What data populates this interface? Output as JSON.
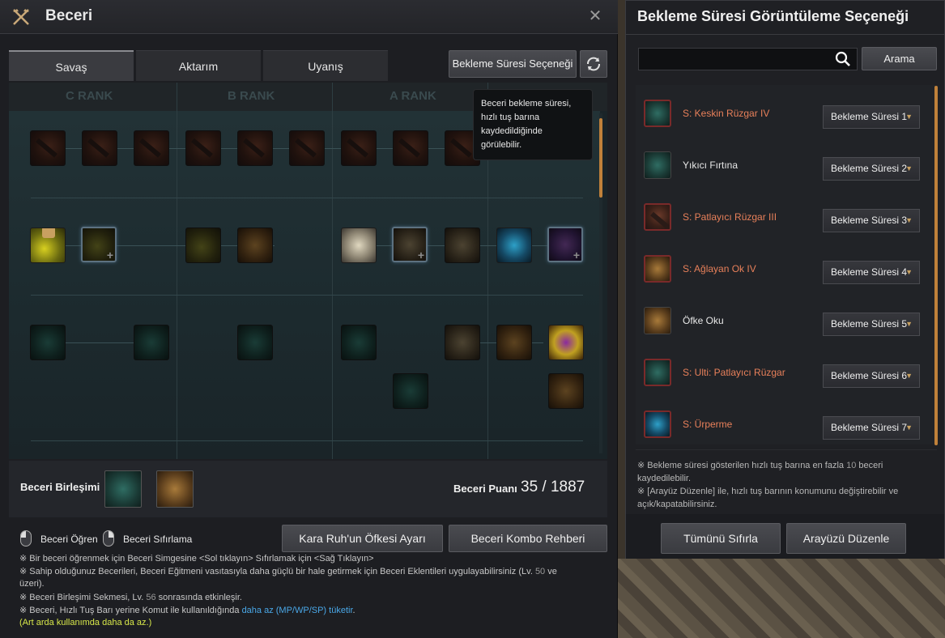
{
  "skill_window": {
    "title": "Beceri",
    "close": "✕",
    "tabs": [
      "Savaş",
      "Aktarım",
      "Uyanış"
    ],
    "cooldown_option_button": "Bekleme Süresi Seçeneği",
    "ranks": [
      "C RANK",
      "B RANK",
      "A RANK"
    ],
    "tooltip": "Beceri bekleme süresi, hızlı tuş barına kaydedildiğinde görülebilir.",
    "combine_label": "Beceri Birleşimi",
    "skill_points_label": "Beceri Puanı",
    "skill_points_value": "35 / 1887",
    "learn_hint": "Beceri Öğren",
    "reset_hint": "Beceri Sıfırlama",
    "rage_button": "Kara Ruh'un Öfkesi Ayarı",
    "combo_button": "Beceri Kombo Rehberi",
    "notes": {
      "n1": "※ Bir beceri öğrenmek için Beceri Simgesine <Sol tıklayın> Sıfırlamak için <Sağ Tıklayın>",
      "n2a": "※ Sahip olduğunuz Becerileri, Beceri Eğitmeni vasıtasıyla daha güçlü bir hale getirmek için Beceri Eklentileri uygulayabilirsiniz (Lv. ",
      "n2num": "50",
      "n2b": " ve",
      "n2c": "üzeri).",
      "n3a": "※ Beceri Birleşimi Sekmesi, Lv. ",
      "n3num": "56",
      "n3b": " sonrasında etkinleşir.",
      "n4a": "※ Beceri, Hızlı Tuş Barı yerine Komut ile kullanıldığında ",
      "n4blue": "daha az (MP/WP/SP) tüketir",
      "n4b": ".",
      "n5": "(Art arda kullanımda daha da az.)"
    }
  },
  "cooldown_panel": {
    "title": "Bekleme Süresi Görüntüleme Seçeneği",
    "search_placeholder": "",
    "search_button": "Arama",
    "rows": [
      {
        "name": "S: Keskin Rüzgar IV",
        "value": "Bekleme Süresi 1",
        "color": "red"
      },
      {
        "name": "Yıkıcı Fırtına",
        "value": "Bekleme Süresi 2",
        "color": "white"
      },
      {
        "name": "S: Patlayıcı Rüzgar III",
        "value": "Bekleme Süresi 3",
        "color": "red"
      },
      {
        "name": "S: Ağlayan Ok IV",
        "value": "Bekleme Süresi 4",
        "color": "red"
      },
      {
        "name": "Öfke Oku",
        "value": "Bekleme Süresi 5",
        "color": "white"
      },
      {
        "name": "S: Ulti: Patlayıcı Rüzgar",
        "value": "Bekleme Süresi 6",
        "color": "red"
      },
      {
        "name": "S: Ürperme",
        "value": "Bekleme Süresi 7",
        "color": "red"
      }
    ],
    "note1a": "※ Bekleme süresi gösterilen hızlı tuş barına en fazla ",
    "note1num": "10",
    "note1b": " beceri",
    "note1c": "kaydedilebilir.",
    "note2": "※ [Arayüz Düzenle] ile, hızlı tuş barının konumunu değiştirebilir ve açık/kapatabilirsiniz.",
    "reset_all": "Tümünü Sıfırla",
    "edit_ui": "Arayüzü Düzenle"
  },
  "colors": {
    "accent": "#c0813a",
    "red_name": "#e8805a",
    "link_blue": "#4aa8e8",
    "green_note": "#d8e84a"
  }
}
